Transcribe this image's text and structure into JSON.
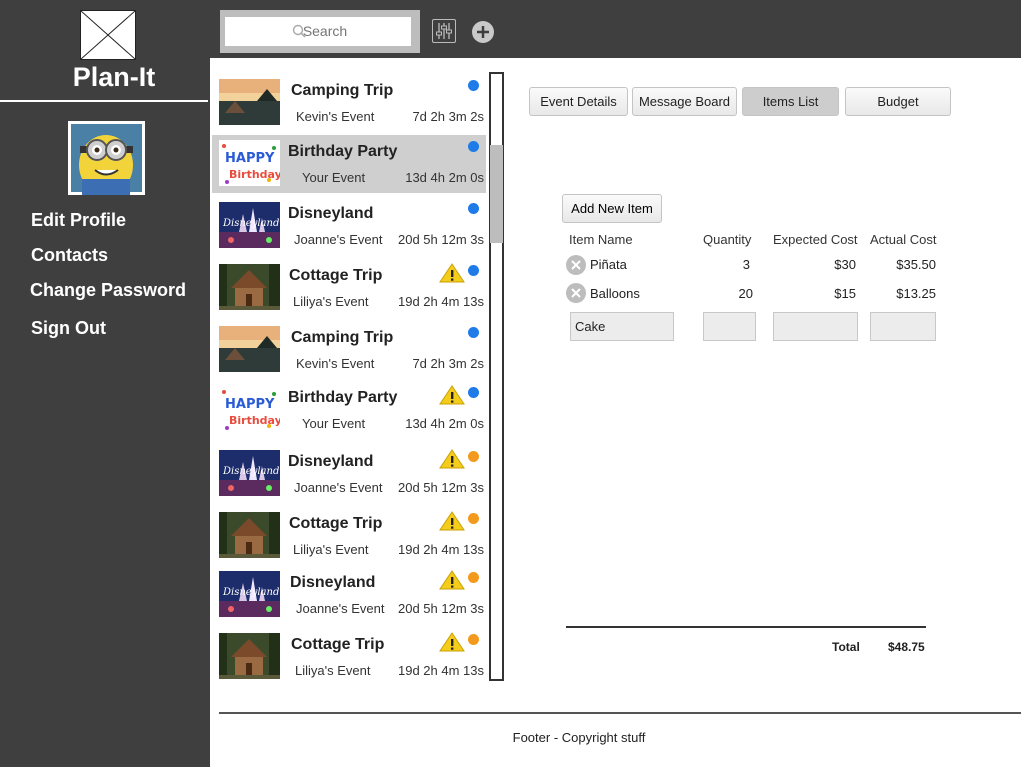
{
  "app": {
    "title": "Plan-It",
    "nav": [
      "Edit Profile",
      "Contacts",
      "Change Password",
      "Sign Out"
    ]
  },
  "toolbar": {
    "search_placeholder": "Search"
  },
  "events": [
    {
      "name": "Camping Trip",
      "host": "Kevin's Event",
      "time": "7d 2h 3m 2s",
      "status": "blue",
      "warning": false,
      "thumb": "camping"
    },
    {
      "name": "Birthday Party",
      "host": "Your Event",
      "time": "13d 4h 2m 0s",
      "status": "blue",
      "warning": false,
      "thumb": "birthday",
      "selected": true
    },
    {
      "name": "Disneyland",
      "host": "Joanne's Event",
      "time": "20d 5h 12m 3s",
      "status": "blue",
      "warning": false,
      "thumb": "disney"
    },
    {
      "name": "Cottage Trip",
      "host": "Liliya's Event",
      "time": "19d 2h 4m 13s",
      "status": "blue",
      "warning": true,
      "thumb": "cottage"
    },
    {
      "name": "Camping Trip",
      "host": "Kevin's Event",
      "time": "7d 2h 3m 2s",
      "status": "blue",
      "warning": false,
      "thumb": "camping"
    },
    {
      "name": "Birthday Party",
      "host": "Your Event",
      "time": "13d 4h 2m 0s",
      "status": "blue",
      "warning": true,
      "thumb": "birthday"
    },
    {
      "name": "Disneyland",
      "host": "Joanne's Event",
      "time": "20d 5h 12m 3s",
      "status": "orange",
      "warning": true,
      "thumb": "disney"
    },
    {
      "name": "Cottage Trip",
      "host": "Liliya's Event",
      "time": "19d 2h 4m 13s",
      "status": "orange",
      "warning": true,
      "thumb": "cottage"
    },
    {
      "name": "Disneyland",
      "host": "Joanne's Event",
      "time": "20d 5h 12m 3s",
      "status": "orange",
      "warning": true,
      "thumb": "disney"
    },
    {
      "name": "Cottage Trip",
      "host": "Liliya's Event",
      "time": "19d 2h 4m 13s",
      "status": "orange",
      "warning": true,
      "thumb": "cottage"
    }
  ],
  "tabs": [
    {
      "label": "Event Details",
      "active": false
    },
    {
      "label": "Message Board",
      "active": false
    },
    {
      "label": "Items List",
      "active": true
    },
    {
      "label": "Budget",
      "active": false
    }
  ],
  "items": {
    "add_label": "Add New Item",
    "columns": [
      "Item Name",
      "Quantity",
      "Expected Cost",
      "Actual Cost"
    ],
    "rows": [
      {
        "name": "Piñata",
        "quantity": "3",
        "expected": "$30",
        "actual": "$35.50"
      },
      {
        "name": "Balloons",
        "quantity": "20",
        "expected": "$15",
        "actual": "$13.25"
      }
    ],
    "new_row": {
      "name": "Cake",
      "quantity": "",
      "expected": "",
      "actual": ""
    },
    "total_label": "Total",
    "total_value": "$48.75"
  },
  "footer": "Footer - Copyright stuff",
  "colors": {
    "sidebar": "#3f3f3f",
    "status_blue": "#1e7be8",
    "status_orange": "#f39a1e",
    "warning": "#f4cc1b"
  }
}
